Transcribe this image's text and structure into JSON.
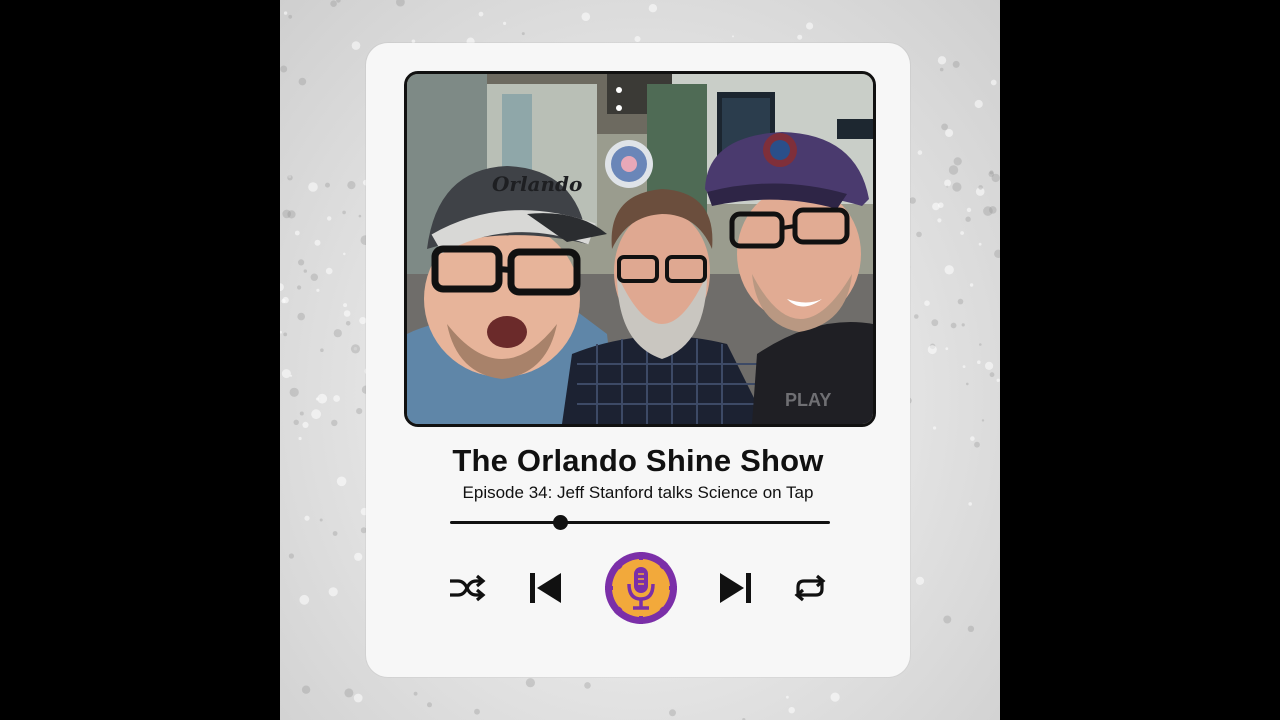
{
  "player": {
    "show_title": "The Orlando Shine Show",
    "episode_title": "Episode 34: Jeff Stanford talks Science on Tap",
    "progress": 0.29
  },
  "artwork": {
    "cap_text": "Orlando",
    "shirt_text": "PLAY"
  },
  "controls": {
    "shuffle_icon": "shuffle-icon",
    "previous_icon": "skip-previous-icon",
    "play_icon": "podcast-microphone-icon",
    "next_icon": "skip-next-icon",
    "repeat_icon": "repeat-icon"
  },
  "colors": {
    "accent_purple": "#7b2fa8",
    "accent_orange": "#f2a93b",
    "text": "#111111",
    "card": "#f7f7f7"
  }
}
